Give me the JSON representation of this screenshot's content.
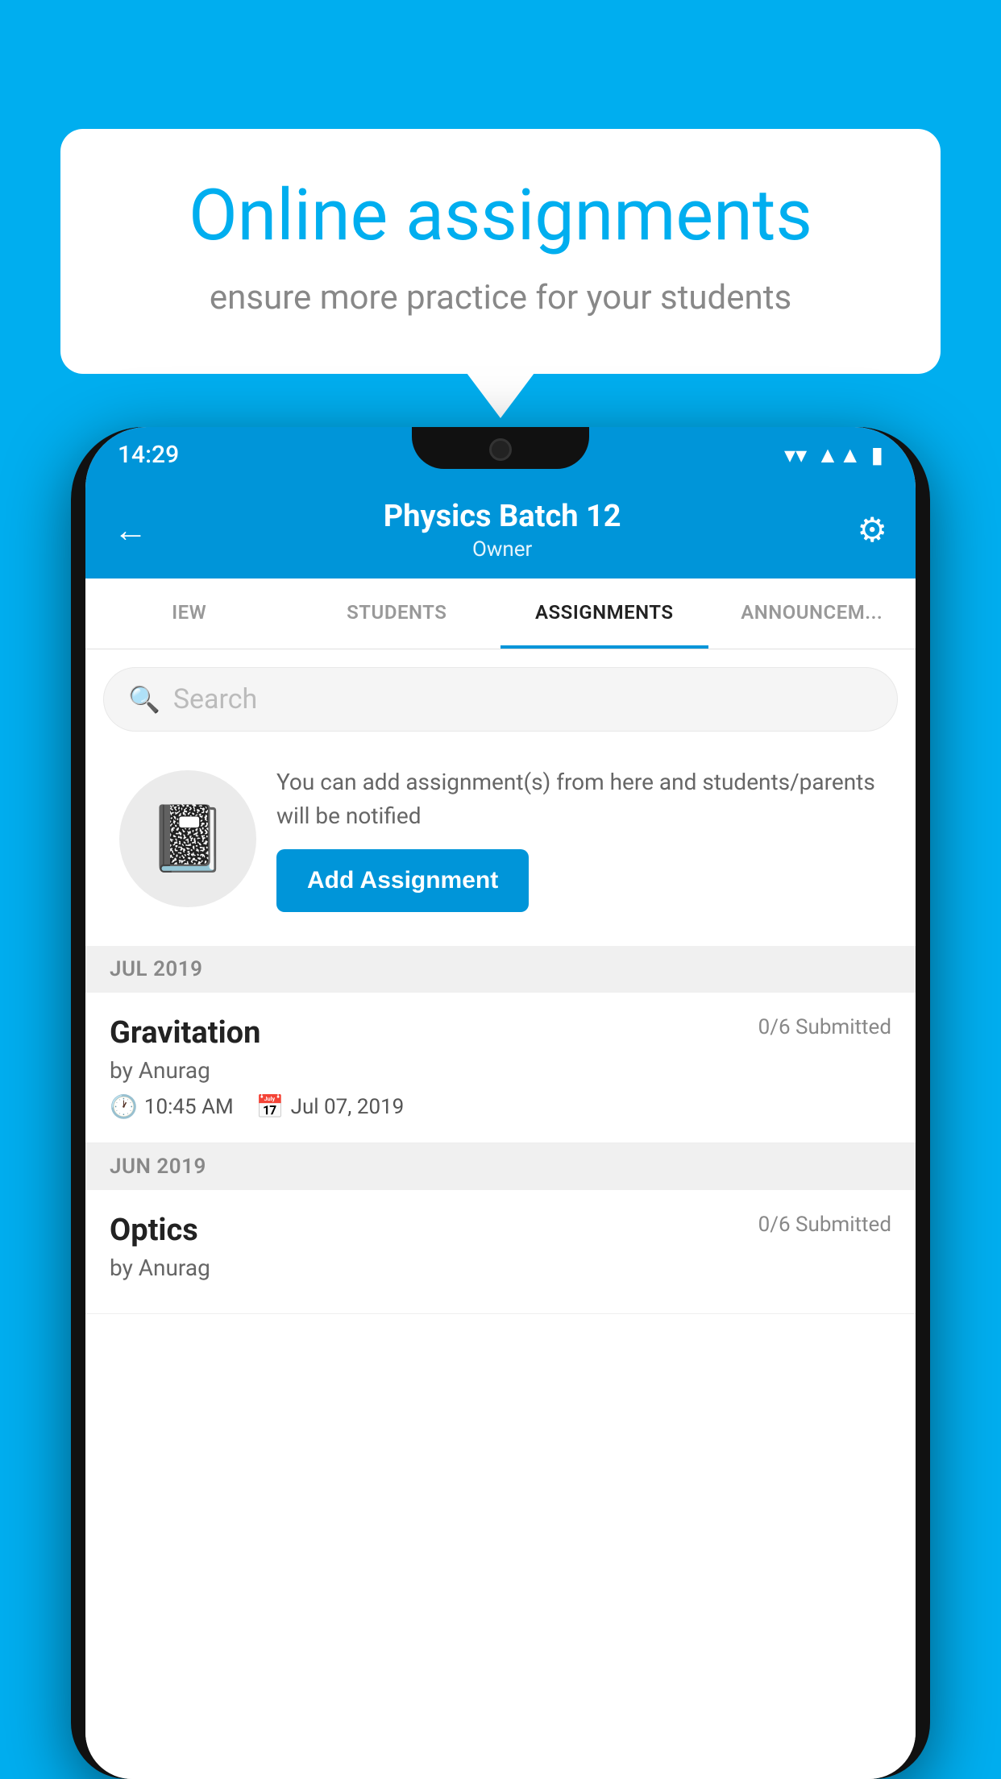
{
  "background_color": "#00AEEF",
  "speech_bubble": {
    "title": "Online assignments",
    "subtitle": "ensure more practice for your students"
  },
  "phone": {
    "status_bar": {
      "time": "14:29",
      "icons": [
        "wifi",
        "signal",
        "battery"
      ]
    },
    "header": {
      "title": "Physics Batch 12",
      "subtitle": "Owner",
      "back_label": "←",
      "settings_label": "⚙"
    },
    "tabs": [
      {
        "label": "IEW",
        "active": false
      },
      {
        "label": "STUDENTS",
        "active": false
      },
      {
        "label": "ASSIGNMENTS",
        "active": true
      },
      {
        "label": "ANNOUNCEM...",
        "active": false
      }
    ],
    "search": {
      "placeholder": "Search"
    },
    "empty_state": {
      "description": "You can add assignment(s) from here and students/parents will be notified",
      "button_label": "Add Assignment"
    },
    "sections": [
      {
        "month": "JUL 2019",
        "assignments": [
          {
            "name": "Gravitation",
            "submitted": "0/6 Submitted",
            "author": "by Anurag",
            "time": "10:45 AM",
            "date": "Jul 07, 2019"
          }
        ]
      },
      {
        "month": "JUN 2019",
        "assignments": [
          {
            "name": "Optics",
            "submitted": "0/6 Submitted",
            "author": "by Anurag",
            "time": "",
            "date": ""
          }
        ]
      }
    ]
  }
}
